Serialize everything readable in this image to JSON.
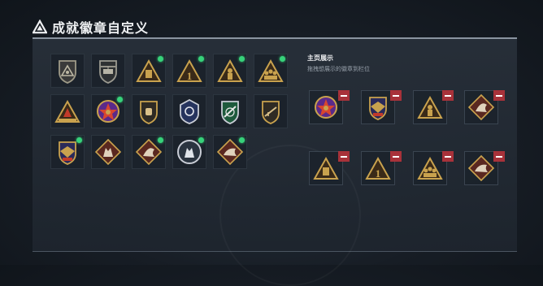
{
  "title": "成就徽章自定义",
  "right": {
    "heading": "主页展示",
    "subheading": "拖拽想展示的徽章到栏位"
  },
  "colors": {
    "gold": "#c9a24e",
    "green": "#37d27a",
    "remove": "#a8323a"
  },
  "badges": [
    {
      "icon": "triangle-shield-badge-icon",
      "badge": "none"
    },
    {
      "icon": "helicopter-badge-icon",
      "badge": "none"
    },
    {
      "icon": "triangle-card-badge-icon",
      "badge": "new"
    },
    {
      "icon": "triangle-number-one-badge-icon",
      "badge": "new"
    },
    {
      "icon": "triangle-soldier-badge-icon",
      "badge": "new"
    },
    {
      "icon": "triangle-squad-badge-icon",
      "badge": "new"
    },
    {
      "icon": "triangle-ornate-badge-icon",
      "badge": "none"
    },
    {
      "icon": "star-medal-badge-icon",
      "badge": "new"
    },
    {
      "icon": "fist-shield-badge-icon",
      "badge": "none"
    },
    {
      "icon": "police-badge-icon",
      "badge": "none"
    },
    {
      "icon": "green-rifle-shield-badge-icon",
      "badge": "none"
    },
    {
      "icon": "rifle-shield-badge-icon",
      "badge": "none"
    },
    {
      "icon": "eagle-crest-badge-icon",
      "badge": "new"
    },
    {
      "icon": "wolf-diamond-badge-icon",
      "badge": "none"
    },
    {
      "icon": "dragon-diamond-badge-icon",
      "badge": "new"
    },
    {
      "icon": "wolf-circle-badge-icon",
      "badge": "new"
    },
    {
      "icon": "dinosaur-diamond-badge-icon",
      "badge": "new"
    }
  ],
  "showcase": [
    {
      "icon": "star-medal-badge-icon"
    },
    {
      "icon": "eagle-crest-badge-icon"
    },
    {
      "icon": "triangle-soldier-badge-icon"
    },
    {
      "icon": "dragon-diamond-badge-icon"
    },
    {
      "icon": "triangle-card-badge-icon"
    },
    {
      "icon": "triangle-number-one-badge-icon"
    },
    {
      "icon": "triangle-squad-badge-icon"
    },
    {
      "icon": "dinosaur-diamond-badge-icon"
    }
  ]
}
